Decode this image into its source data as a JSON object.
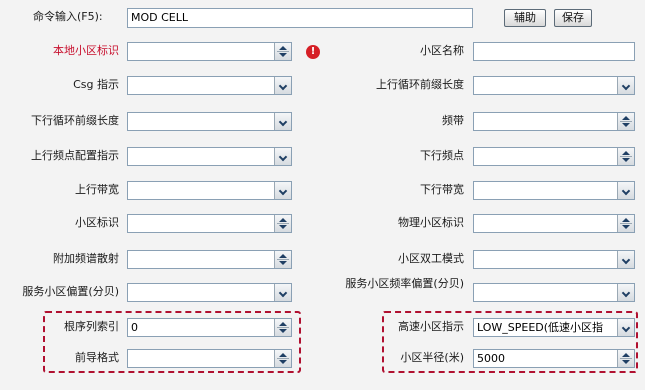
{
  "command": {
    "label": "命令输入(F5):",
    "value": "MOD CELL"
  },
  "buttons": {
    "help": "辅助",
    "save": "保存"
  },
  "left_fields": [
    {
      "label": "本地小区标识",
      "value": "",
      "control": "spin",
      "required": true
    },
    {
      "label": "Csg 指示",
      "value": "",
      "control": "dropdown"
    },
    {
      "label": "下行循环前缀长度",
      "value": "",
      "control": "dropdown"
    },
    {
      "label": "上行频点配置指示",
      "value": "",
      "control": "dropdown"
    },
    {
      "label": "上行带宽",
      "value": "",
      "control": "dropdown"
    },
    {
      "label": "小区标识",
      "value": "",
      "control": "spin"
    },
    {
      "label": "附加频谱散射",
      "value": "",
      "control": "spin"
    },
    {
      "label": "服务小区偏置(分贝)",
      "value": "",
      "control": "dropdown"
    },
    {
      "label": "根序列索引",
      "value": "0",
      "control": "spin"
    },
    {
      "label": "前导格式",
      "value": "",
      "control": "spin"
    }
  ],
  "right_fields": [
    {
      "label": "小区名称",
      "value": "",
      "control": "none"
    },
    {
      "label": "上行循环前缀长度",
      "value": "",
      "control": "dropdown"
    },
    {
      "label": "频带",
      "value": "",
      "control": "spin"
    },
    {
      "label": "下行频点",
      "value": "",
      "control": "spin"
    },
    {
      "label": "下行带宽",
      "value": "",
      "control": "dropdown"
    },
    {
      "label": "物理小区标识",
      "value": "",
      "control": "spin"
    },
    {
      "label": "小区双工模式",
      "value": "",
      "control": "dropdown"
    },
    {
      "label": "服务小区频率偏置(分贝)",
      "value": "",
      "control": "dropdown"
    },
    {
      "label": "高速小区指示",
      "value": "LOW_SPEED(低速小区指",
      "control": "dropdown"
    },
    {
      "label": "小区半径(米)",
      "value": "5000",
      "control": "spin"
    }
  ],
  "warning_icon": "exclamation-icon",
  "colors": {
    "required_label": "#c8102e",
    "highlight_border": "#b01030",
    "warning": "#d61f26"
  }
}
